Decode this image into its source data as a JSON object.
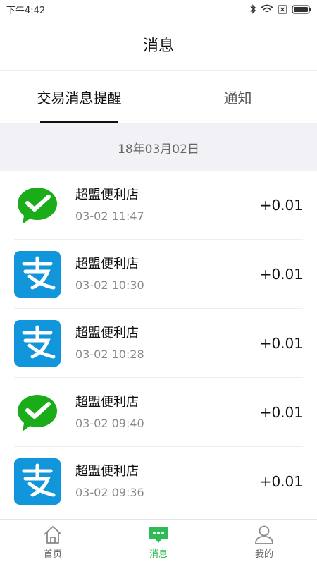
{
  "status": {
    "time": "下午4:42"
  },
  "header": {
    "title": "消息"
  },
  "tabs": [
    {
      "label": "交易消息提醒",
      "active": true
    },
    {
      "label": "通知",
      "active": false
    }
  ],
  "date_header": "18年03月02日",
  "transactions": [
    {
      "icon": "wechat-pay-icon",
      "merchant": "超盟便利店",
      "time": "03-02 11:47",
      "amount": "+0.01"
    },
    {
      "icon": "alipay-icon",
      "merchant": "超盟便利店",
      "time": "03-02 10:30",
      "amount": "+0.01"
    },
    {
      "icon": "alipay-icon",
      "merchant": "超盟便利店",
      "time": "03-02 10:28",
      "amount": "+0.01"
    },
    {
      "icon": "wechat-pay-icon",
      "merchant": "超盟便利店",
      "time": "03-02 09:40",
      "amount": "+0.01"
    },
    {
      "icon": "alipay-icon",
      "merchant": "超盟便利店",
      "time": "03-02 09:36",
      "amount": "+0.01"
    }
  ],
  "bottom_nav": [
    {
      "label": "首页",
      "icon": "home-icon",
      "active": false
    },
    {
      "label": "消息",
      "icon": "message-icon",
      "active": true
    },
    {
      "label": "我的",
      "icon": "user-icon",
      "active": false
    }
  ],
  "colors": {
    "wechat_green": "#1aad19",
    "alipay_blue": "#1296db",
    "active_nav": "#2dbb55"
  }
}
